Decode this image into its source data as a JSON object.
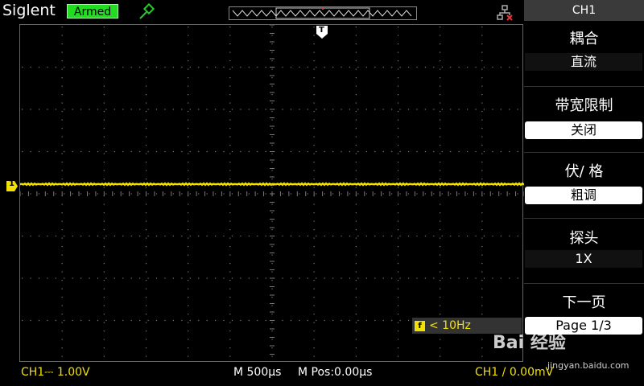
{
  "header": {
    "brand": "Siglent",
    "status": "Armed"
  },
  "screen": {
    "trigger_marker": "T",
    "channel_marker": "1",
    "freq_icon": "f",
    "freq_text": "< 10Hz"
  },
  "menu": {
    "title": "CH1",
    "items": [
      {
        "label": "耦合",
        "value": "直流"
      },
      {
        "label": "带宽限制",
        "value": "关闭"
      },
      {
        "label": "伏/ 格",
        "value": "粗调"
      },
      {
        "label": "探头",
        "value": "1X"
      },
      {
        "label": "下一页",
        "value": "Page 1/3"
      }
    ]
  },
  "footer": {
    "ch1_scale": "CH1⎓ 1.00V",
    "timebase": "M 500µs",
    "mpos": "M Pos:0.00µs",
    "trigger": "CH1 / 0.00mV"
  },
  "watermark": {
    "brand": "Bai 经验",
    "url": "jingyan.baidu.com"
  },
  "colors": {
    "trace": "#f2e000",
    "status_bg": "#22dd22",
    "grid": "#7a7a7a"
  }
}
